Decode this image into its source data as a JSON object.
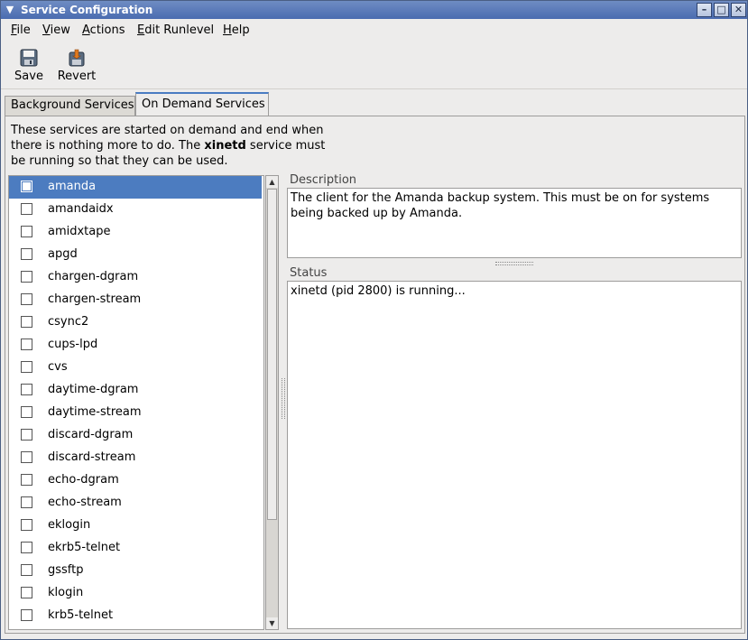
{
  "window": {
    "title": "Service Configuration"
  },
  "menubar": {
    "items": [
      {
        "label": "File",
        "mnemonic": "F"
      },
      {
        "label": "View",
        "mnemonic": "V"
      },
      {
        "label": "Actions",
        "mnemonic": "A"
      },
      {
        "label": "Edit Runlevel",
        "mnemonic": "E"
      },
      {
        "label": "Help",
        "mnemonic": "H"
      }
    ]
  },
  "toolbar": {
    "save_label": "Save",
    "revert_label": "Revert"
  },
  "tabs": [
    {
      "label": "Background Services",
      "active": false
    },
    {
      "label": "On Demand Services",
      "active": true
    }
  ],
  "intro": {
    "part1": "These services are started on demand and end when there is nothing more to do. The ",
    "bold": "xinetd",
    "part2": " service must be running so that they can be used."
  },
  "services": [
    {
      "name": "amanda",
      "checked": false,
      "selected": true
    },
    {
      "name": "amandaidx",
      "checked": false
    },
    {
      "name": "amidxtape",
      "checked": false
    },
    {
      "name": "apgd",
      "checked": false
    },
    {
      "name": "chargen-dgram",
      "checked": false
    },
    {
      "name": "chargen-stream",
      "checked": false
    },
    {
      "name": "csync2",
      "checked": false
    },
    {
      "name": "cups-lpd",
      "checked": false
    },
    {
      "name": "cvs",
      "checked": false
    },
    {
      "name": "daytime-dgram",
      "checked": false
    },
    {
      "name": "daytime-stream",
      "checked": false
    },
    {
      "name": "discard-dgram",
      "checked": false
    },
    {
      "name": "discard-stream",
      "checked": false
    },
    {
      "name": "echo-dgram",
      "checked": false
    },
    {
      "name": "echo-stream",
      "checked": false
    },
    {
      "name": "eklogin",
      "checked": false
    },
    {
      "name": "ekrb5-telnet",
      "checked": false
    },
    {
      "name": "gssftp",
      "checked": false
    },
    {
      "name": "klogin",
      "checked": false
    },
    {
      "name": "krb5-telnet",
      "checked": false
    }
  ],
  "description": {
    "label": "Description",
    "text": "The client for the Amanda backup system. This must be on for systems being backed up by Amanda."
  },
  "status": {
    "label": "Status",
    "text": "xinetd (pid 2800) is running..."
  },
  "colors": {
    "selection": "#4c7cc0",
    "titlebar": "#5a78b8",
    "tab_accent": "#4a7cc2"
  },
  "icons": [
    "save-icon",
    "revert-icon",
    "window-menu-icon",
    "minimize-icon",
    "maximize-icon",
    "close-icon"
  ]
}
